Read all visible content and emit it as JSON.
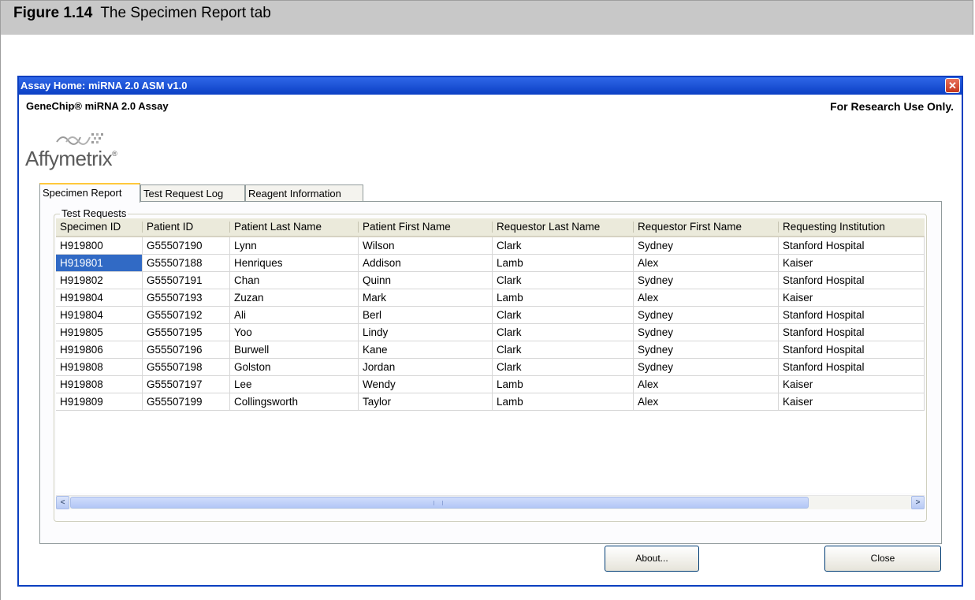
{
  "figure": {
    "label": "Figure 1.14",
    "caption": "The Specimen Report tab"
  },
  "window": {
    "title": "Assay Home: miRNA 2.0 ASM v1.0",
    "close_glyph": "✕",
    "app_name": "GeneChip® miRNA 2.0 Assay",
    "notice": "For Research Use Only.",
    "logo_text": "Affymetrix",
    "logo_mark": "®"
  },
  "tabs": [
    {
      "label": "Specimen Report",
      "active": true
    },
    {
      "label": "Test Request Log",
      "active": false
    },
    {
      "label": "Reagent Information",
      "active": false
    }
  ],
  "group": {
    "label": "Test Requests"
  },
  "table": {
    "columns": [
      "Specimen ID",
      "Patient ID",
      "Patient Last Name",
      "Patient First Name",
      "Requestor Last Name",
      "Requestor First Name",
      "Requesting Institution"
    ],
    "rows": [
      [
        "H919800",
        "G55507190",
        "Lynn",
        "Wilson",
        "Clark",
        "Sydney",
        "Stanford Hospital"
      ],
      [
        "H919801",
        "G55507188",
        "Henriques",
        "Addison",
        "Lamb",
        "Alex",
        "Kaiser"
      ],
      [
        "H919802",
        "G55507191",
        "Chan",
        "Quinn",
        "Clark",
        "Sydney",
        "Stanford Hospital"
      ],
      [
        "H919804",
        "G55507193",
        "Zuzan",
        "Mark",
        "Lamb",
        "Alex",
        "Kaiser"
      ],
      [
        "H919804",
        "G55507192",
        "Ali",
        "Berl",
        "Clark",
        "Sydney",
        "Stanford Hospital"
      ],
      [
        "H919805",
        "G55507195",
        "Yoo",
        "Lindy",
        "Clark",
        "Sydney",
        "Stanford Hospital"
      ],
      [
        "H919806",
        "G55507196",
        "Burwell",
        "Kane",
        "Clark",
        "Sydney",
        "Stanford Hospital"
      ],
      [
        "H919808",
        "G55507198",
        "Golston",
        "Jordan",
        "Clark",
        "Sydney",
        "Stanford Hospital"
      ],
      [
        "H919808",
        "G55507197",
        "Lee",
        "Wendy",
        "Lamb",
        "Alex",
        "Kaiser"
      ],
      [
        "H919809",
        "G55507199",
        "Collingsworth",
        "Taylor",
        "Lamb",
        "Alex",
        "Kaiser"
      ]
    ],
    "selected_row": 1,
    "selected_col": 0
  },
  "scrollbar": {
    "left_glyph": "<",
    "right_glyph": ">"
  },
  "buttons": {
    "about": "About...",
    "close": "Close"
  },
  "colors": {
    "titlebar": "#0b3fc4",
    "selection": "#316ac5",
    "tab_accent": "#ffc83c"
  }
}
